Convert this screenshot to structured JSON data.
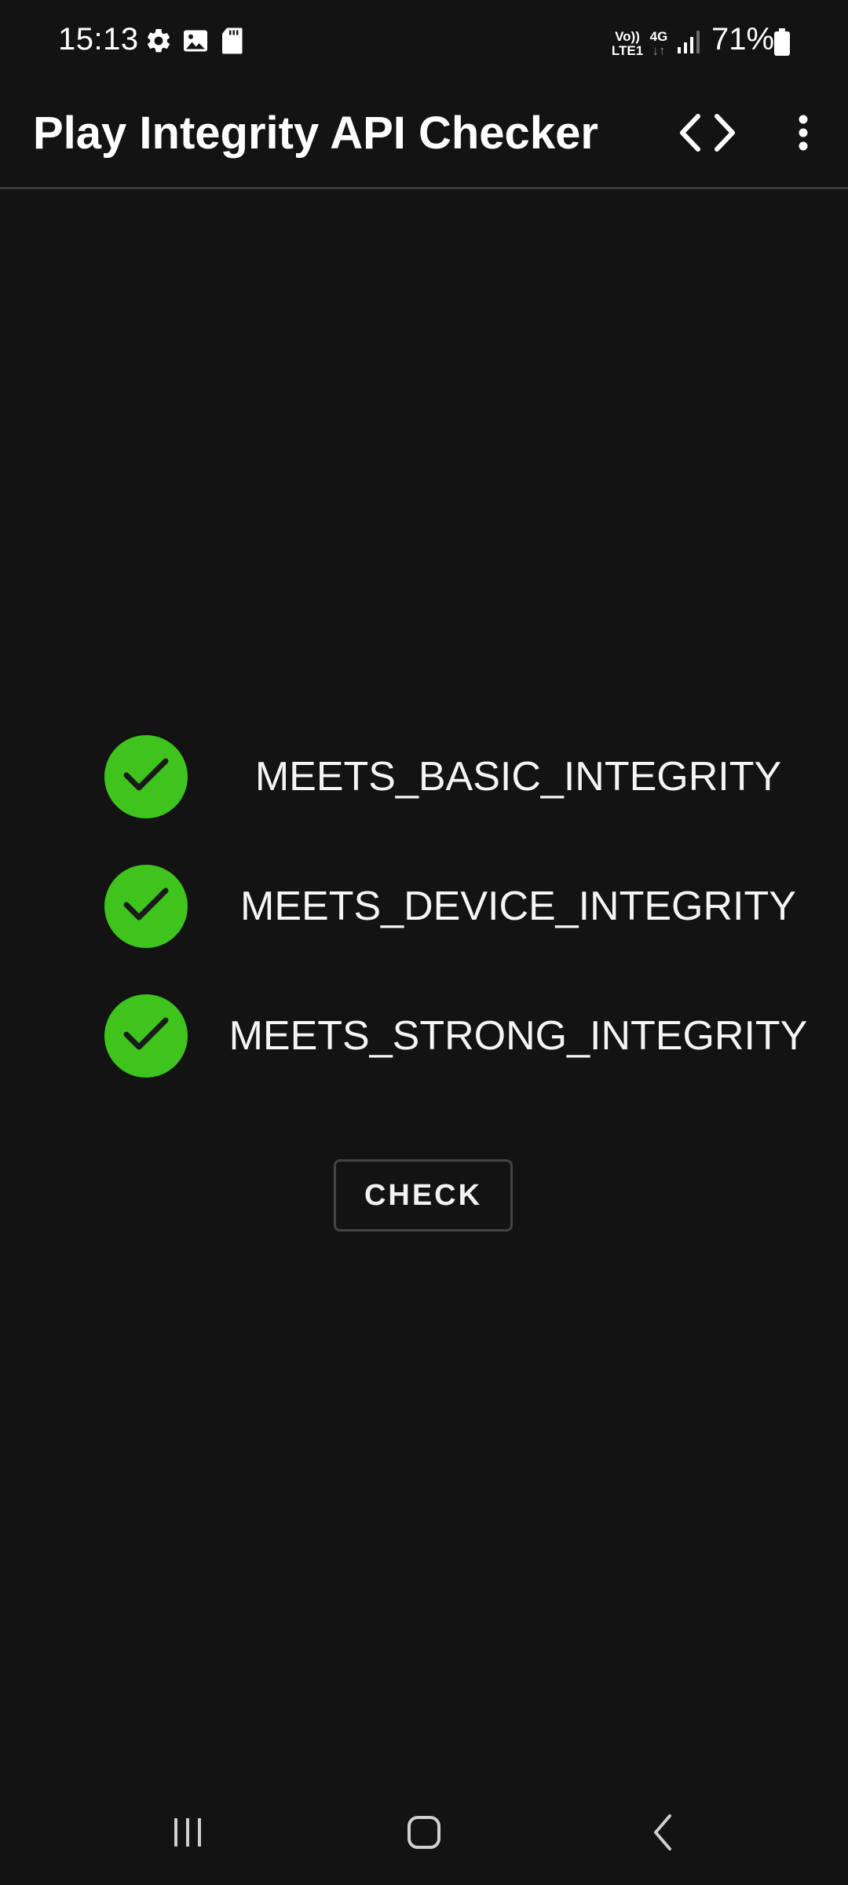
{
  "status_bar": {
    "time": "15:13",
    "left_icons": [
      "settings-gear-icon",
      "gallery-image-icon",
      "sd-card-icon"
    ],
    "volte_label": "Vo))",
    "lte_label": "LTE1",
    "network_type": "4G",
    "network_arrows": "↓↑",
    "battery_percent": "71%"
  },
  "app_bar": {
    "title": "Play Integrity API Checker",
    "actions": [
      "code-icon",
      "more-vert-icon"
    ]
  },
  "checks": [
    {
      "label": "MEETS_BASIC_INTEGRITY",
      "status": "passed",
      "icon": "check-icon"
    },
    {
      "label": "MEETS_DEVICE_INTEGRITY",
      "status": "passed",
      "icon": "check-icon"
    },
    {
      "label": "MEETS_STRONG_INTEGRITY",
      "status": "passed",
      "icon": "check-icon"
    }
  ],
  "check_button": {
    "label": "CHECK"
  },
  "nav_bar": {
    "buttons": [
      "recent-apps-icon",
      "home-icon",
      "back-icon"
    ]
  },
  "colors": {
    "background": "#131313",
    "success": "#3ec41d",
    "text": "#ffffff",
    "divider": "#3a3a3a"
  }
}
